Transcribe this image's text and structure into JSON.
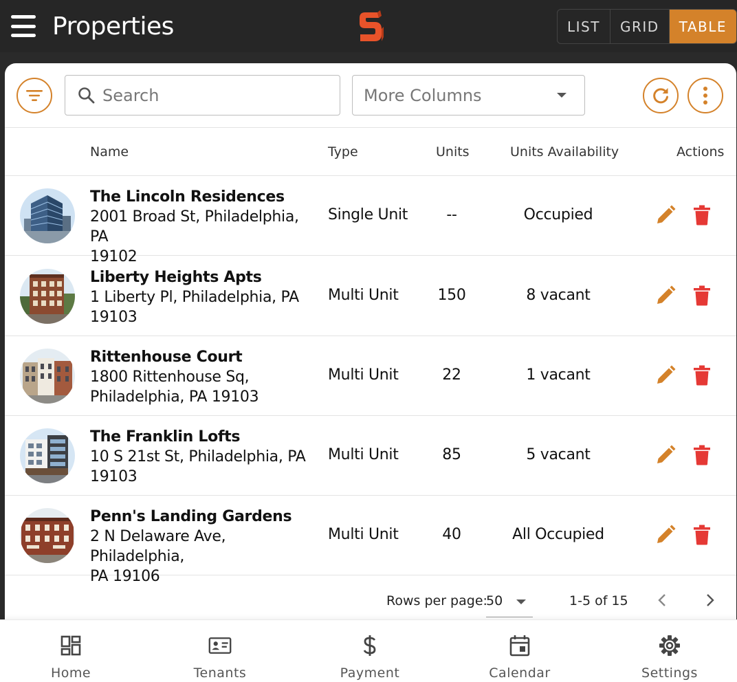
{
  "header": {
    "title": "Properties",
    "views": [
      "LIST",
      "GRID",
      "TABLE"
    ],
    "active_view": "TABLE"
  },
  "toolbar": {
    "search_placeholder": "Search",
    "more_columns_label": "More Columns"
  },
  "table": {
    "columns": [
      "Name",
      "Type",
      "Units",
      "Units Availability",
      "Actions"
    ],
    "rows": [
      {
        "name": "The Lincoln Residences",
        "address_line1": "2001 Broad St, Philadelphia, PA",
        "address_line2": "19102",
        "type": "Single Unit",
        "units": "--",
        "availability": "Occupied",
        "image_icon": "glass-tower-building-icon"
      },
      {
        "name": "Liberty Heights Apts",
        "address_line1": "1 Liberty Pl, Philadelphia, PA",
        "address_line2": "19103",
        "type": "Multi Unit",
        "units": "150",
        "availability": "8 vacant",
        "image_icon": "brick-apartment-building-icon"
      },
      {
        "name": "Rittenhouse Court",
        "address_line1": "1800 Rittenhouse Sq,",
        "address_line2": "Philadelphia, PA 19103",
        "type": "Multi Unit",
        "units": "22",
        "availability": "1 vacant",
        "image_icon": "rowhouse-street-icon"
      },
      {
        "name": "The Franklin Lofts",
        "address_line1": "10 S 21st St, Philadelphia, PA",
        "address_line2": "19103",
        "type": "Multi Unit",
        "units": "85",
        "availability": "5 vacant",
        "image_icon": "modern-loft-building-icon"
      },
      {
        "name": "Penn's Landing Gardens",
        "address_line1": "2 N Delaware Ave, Philadelphia,",
        "address_line2": "PA 19106",
        "type": "Multi Unit",
        "units": "40",
        "availability": "All Occupied",
        "image_icon": "brick-townhouse-icon"
      }
    ]
  },
  "pagination": {
    "rows_per_page_label": "Rows per page:",
    "rows_per_page": "50",
    "range": "1-5 of 15"
  },
  "bottom_nav": [
    {
      "label": "Home",
      "icon": "dashboard-icon"
    },
    {
      "label": "Tenants",
      "icon": "id-card-icon"
    },
    {
      "label": "Payment",
      "icon": "dollar-icon"
    },
    {
      "label": "Calendar",
      "icon": "calendar-icon"
    },
    {
      "label": "Settings",
      "icon": "gear-icon"
    }
  ],
  "colors": {
    "accent": "#d4822a",
    "delete": "#e53935",
    "topbar": "#262626",
    "logo": "#e8532a"
  }
}
